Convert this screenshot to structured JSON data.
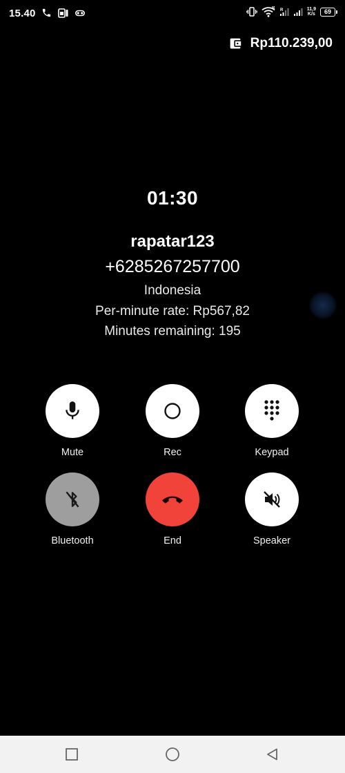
{
  "status_bar": {
    "time": "15.40",
    "net_speed_value": "11,9",
    "net_speed_unit": "K/s",
    "battery": "69",
    "signal_1_label": "R",
    "signal_2_label": "R",
    "icons": [
      "phone-icon",
      "sim-icon",
      "headset-icon",
      "vibrate-icon",
      "wifi-icon",
      "signal-icon",
      "signal-icon",
      "battery-icon"
    ]
  },
  "balance": {
    "icon": "wallet-icon",
    "amount": "Rp110.239,00"
  },
  "call": {
    "timer": "01:30",
    "caller_name": "rapatar123",
    "phone_number": "+6285267257700",
    "country": "Indonesia",
    "rate": "Per-minute rate: Rp567,82",
    "remaining": "Minutes remaining: 195"
  },
  "actions": [
    {
      "label": "Mute",
      "icon": "microphone-icon",
      "color": "#ffffff"
    },
    {
      "label": "Rec",
      "icon": "record-icon",
      "color": "#ffffff"
    },
    {
      "label": "Keypad",
      "icon": "dialpad-icon",
      "color": "#ffffff"
    },
    {
      "label": "Bluetooth",
      "icon": "bluetooth-disabled-icon",
      "color": "#9e9e9e"
    },
    {
      "label": "End",
      "icon": "end-call-icon",
      "color": "#f2433a"
    },
    {
      "label": "Speaker",
      "icon": "speaker-off-icon",
      "color": "#ffffff"
    }
  ],
  "nav": {
    "icons": [
      "recents-icon",
      "home-icon",
      "back-icon"
    ]
  }
}
